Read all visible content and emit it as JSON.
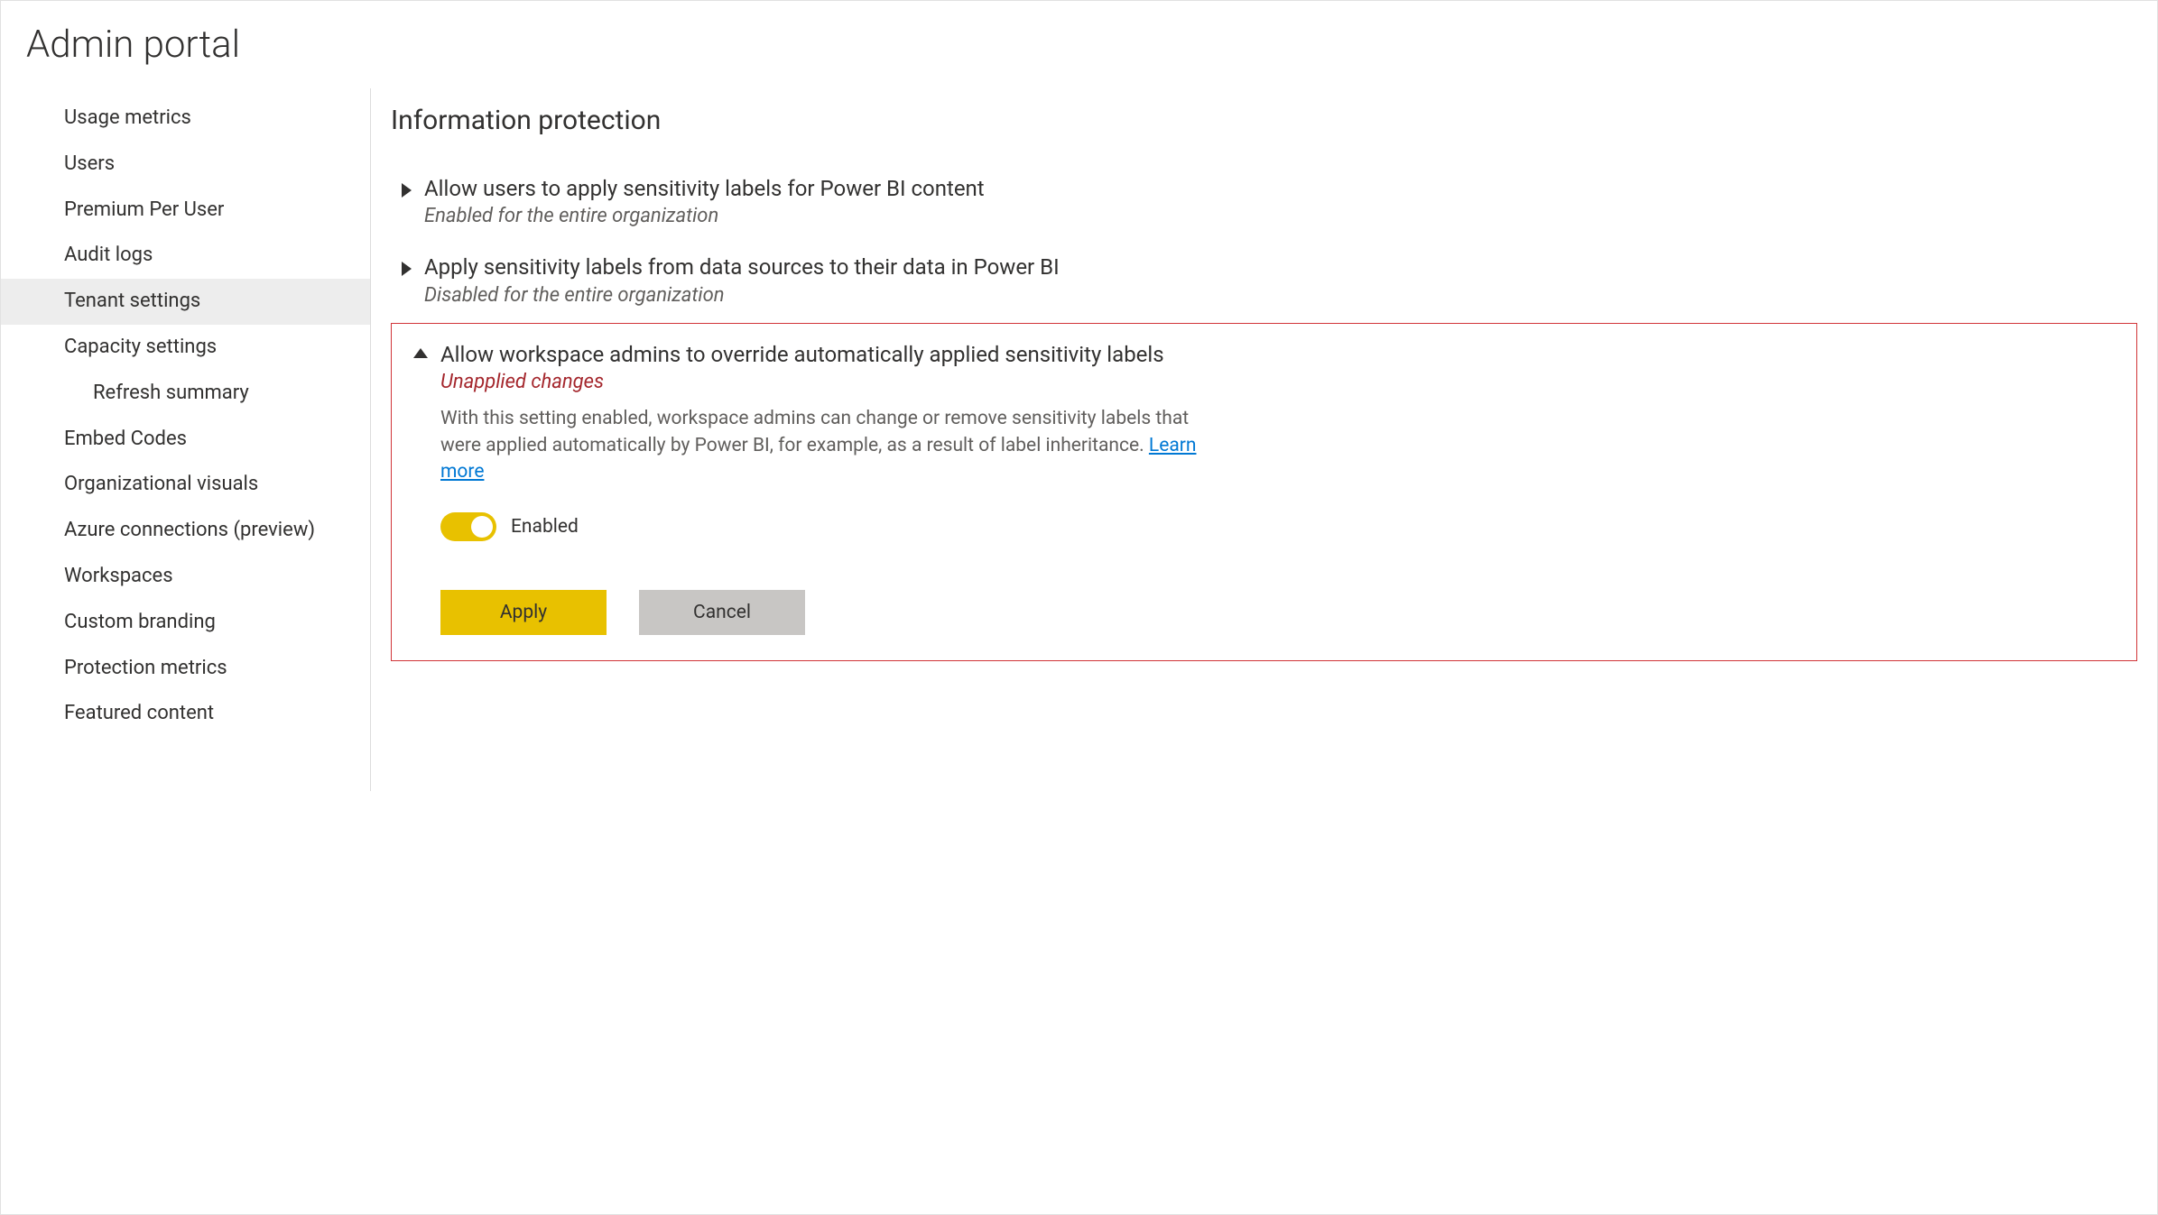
{
  "page_title": "Admin portal",
  "sidebar": {
    "items": [
      {
        "label": "Usage metrics",
        "selected": false,
        "indent": false
      },
      {
        "label": "Users",
        "selected": false,
        "indent": false
      },
      {
        "label": "Premium Per User",
        "selected": false,
        "indent": false
      },
      {
        "label": "Audit logs",
        "selected": false,
        "indent": false
      },
      {
        "label": "Tenant settings",
        "selected": true,
        "indent": false
      },
      {
        "label": "Capacity settings",
        "selected": false,
        "indent": false
      },
      {
        "label": "Refresh summary",
        "selected": false,
        "indent": true
      },
      {
        "label": "Embed Codes",
        "selected": false,
        "indent": false
      },
      {
        "label": "Organizational visuals",
        "selected": false,
        "indent": false
      },
      {
        "label": "Azure connections (preview)",
        "selected": false,
        "indent": false
      },
      {
        "label": "Workspaces",
        "selected": false,
        "indent": false
      },
      {
        "label": "Custom branding",
        "selected": false,
        "indent": false
      },
      {
        "label": "Protection metrics",
        "selected": false,
        "indent": false
      },
      {
        "label": "Featured content",
        "selected": false,
        "indent": false
      }
    ]
  },
  "main": {
    "section_heading": "Information protection",
    "settings": [
      {
        "title": "Allow users to apply sensitivity labels for Power BI content",
        "status": "Enabled for the entire organization",
        "expanded": false
      },
      {
        "title": "Apply sensitivity labels from data sources to their data in Power BI",
        "status": "Disabled for the entire organization",
        "expanded": false
      },
      {
        "title": "Allow workspace admins to override automatically applied sensitivity labels",
        "status": "Unapplied changes",
        "expanded": true,
        "description": "With this setting enabled, workspace admins can change or remove sensitivity labels that were applied automatically by Power BI, for example, as a result of label inheritance.",
        "learn_more": "Learn more",
        "toggle_state": "Enabled",
        "apply_label": "Apply",
        "cancel_label": "Cancel"
      }
    ]
  },
  "colors": {
    "accent_yellow": "#e8c100",
    "link_blue": "#0078d4",
    "warn_red": "#a4262c",
    "highlight_border": "#d13438"
  }
}
